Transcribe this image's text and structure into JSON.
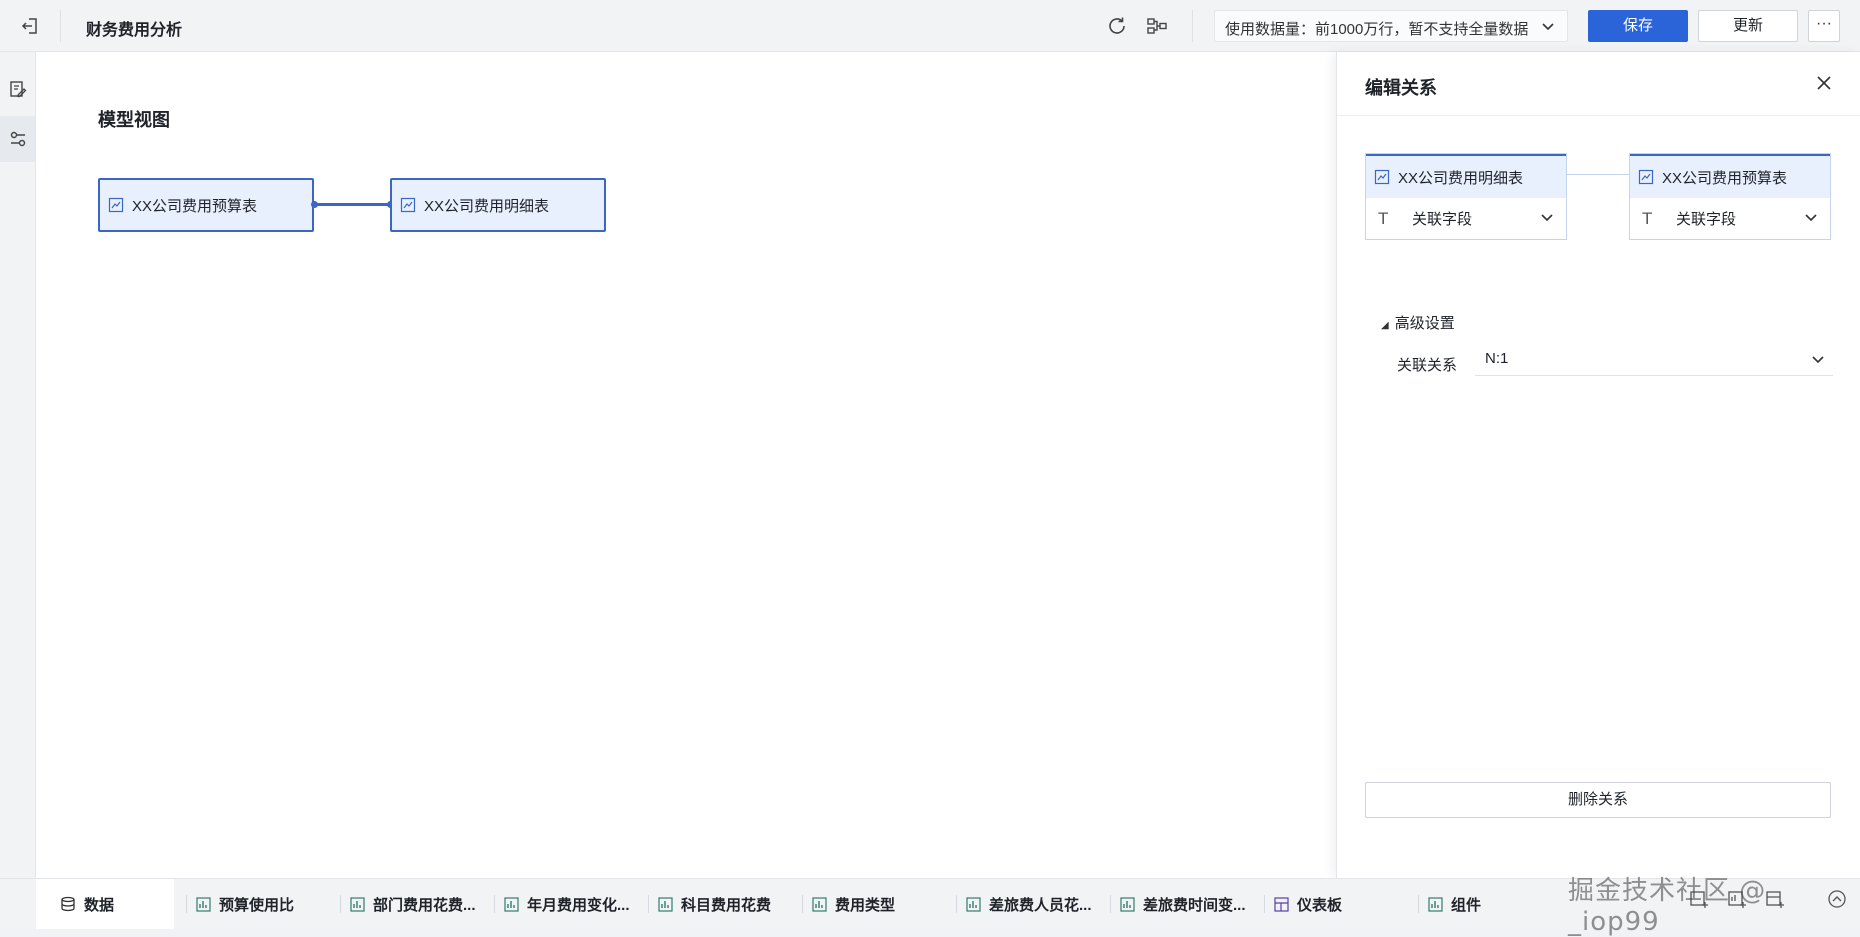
{
  "header": {
    "title": "财务费用分析",
    "data_scope": "使用数据量：前1000万行，暂不支持全量数据",
    "save_label": "保存",
    "update_label": "更新",
    "more_label": "···"
  },
  "canvas": {
    "title": "模型视图",
    "nodes": [
      {
        "label": "XX公司费用预算表"
      },
      {
        "label": "XX公司费用明细表"
      }
    ]
  },
  "panel": {
    "title": "编辑关系",
    "left_table": {
      "name": "XX公司费用明细表",
      "field": "关联字段"
    },
    "right_table": {
      "name": "XX公司费用预算表",
      "field": "关联字段"
    },
    "advanced_label": "高级设置",
    "relation_label": "关联关系",
    "relation_value": "N:1",
    "delete_label": "删除关系"
  },
  "tabs": [
    {
      "label": "数据"
    },
    {
      "label": "预算使用比"
    },
    {
      "label": "部门费用花费..."
    },
    {
      "label": "年月费用变化..."
    },
    {
      "label": "科目费用花费"
    },
    {
      "label": "费用类型"
    },
    {
      "label": "差旅费人员花..."
    },
    {
      "label": "差旅费时间变..."
    },
    {
      "label": "仪表板"
    },
    {
      "label": "组件"
    }
  ],
  "watermark": "掘金技术社区 @ _iop99",
  "colors": {
    "primary": "#2b63d9",
    "node_fill": "#e8f0fd",
    "node_border": "#3a66c4"
  }
}
